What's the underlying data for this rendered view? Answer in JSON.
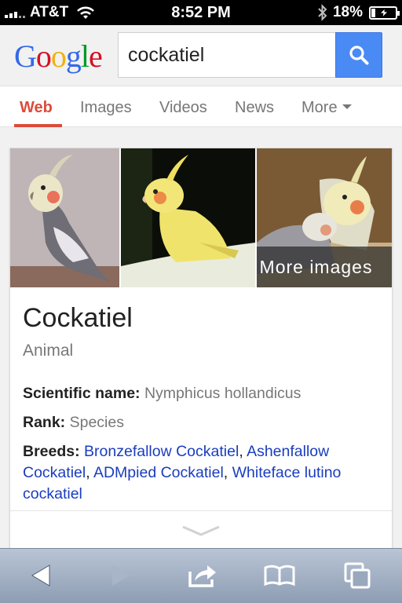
{
  "status_bar": {
    "carrier": "AT&T",
    "time": "8:52 PM",
    "battery": "18%",
    "battery_level": 0.18,
    "icons": [
      "signal-icon",
      "wifi-icon",
      "bluetooth-icon",
      "battery-icon"
    ]
  },
  "search": {
    "logo": "Google",
    "query": "cockatiel",
    "search_button_icon": "search-icon"
  },
  "tabs": [
    {
      "label": "Web",
      "active": true
    },
    {
      "label": "Images",
      "active": false
    },
    {
      "label": "Videos",
      "active": false
    },
    {
      "label": "News",
      "active": false
    },
    {
      "label": "More",
      "active": false
    }
  ],
  "knowledge_card": {
    "more_images": "More images",
    "title": "Cockatiel",
    "subtitle": "Animal",
    "facts": {
      "scientific_name_label": "Scientific name:",
      "scientific_name_value": "Nymphicus hollandicus",
      "rank_label": "Rank:",
      "rank_value": "Species",
      "breeds_label": "Breeds:",
      "breeds": [
        "Bronzefallow Cockatiel",
        "Ashenfallow Cockatiel",
        "ADMpied Cockatiel",
        "Whiteface lutino cockatiel"
      ]
    }
  },
  "toolbar": {
    "icons": [
      "back-icon",
      "forward-icon",
      "share-icon",
      "bookmarks-icon",
      "tabs-icon"
    ]
  },
  "colors": {
    "accent_red": "#dd4b39",
    "link_blue": "#1a3dbd",
    "search_blue": "#4a8af4"
  }
}
